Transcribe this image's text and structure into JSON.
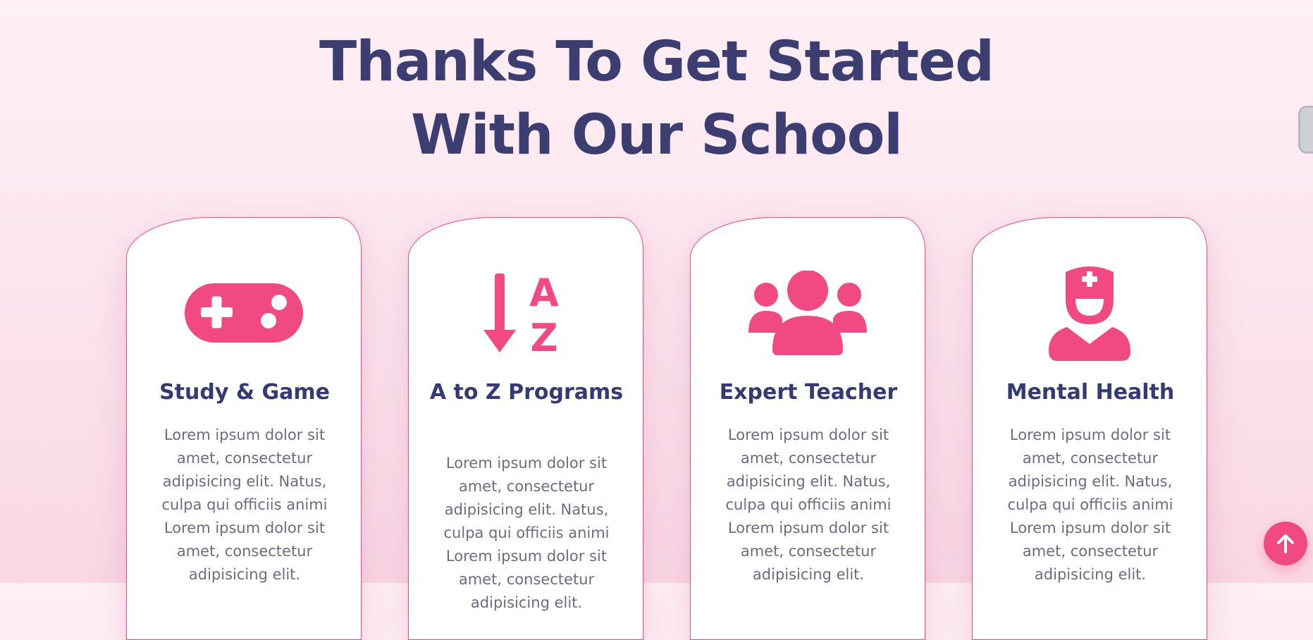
{
  "heading": {
    "line1": "Thanks To Get Started",
    "line2": "With Our School"
  },
  "colors": {
    "accent": "#f14a82",
    "heading": "#3c3e72",
    "title": "#363a74",
    "body_text": "#6b6b85",
    "background": "#fce6ef"
  },
  "cards": [
    {
      "icon": "gamepad-icon",
      "title": "Study & Game",
      "description": "Lorem ipsum dolor sit amet, consectetur adipisicing elit. Natus, culpa qui officiis animi Lorem ipsum dolor sit amet, consectetur adipisicing elit."
    },
    {
      "icon": "sort-a-z-icon",
      "title": "A to Z Programs",
      "description": "Lorem ipsum dolor sit amet, consectetur adipisicing elit. Natus, culpa qui officiis animi Lorem ipsum dolor sit amet, consectetur adipisicing elit."
    },
    {
      "icon": "users-group-icon",
      "title": "Expert Teacher",
      "description": "Lorem ipsum dolor sit amet, consectetur adipisicing elit. Natus, culpa qui officiis animi Lorem ipsum dolor sit amet, consectetur adipisicing elit."
    },
    {
      "icon": "nurse-icon",
      "title": "Mental Health",
      "description": "Lorem ipsum dolor sit amet, consectetur adipisicing elit. Natus, culpa qui officiis animi Lorem ipsum dolor sit amet, consectetur adipisicing elit."
    }
  ],
  "scroll_to_top": {
    "icon": "arrow-up-icon"
  }
}
